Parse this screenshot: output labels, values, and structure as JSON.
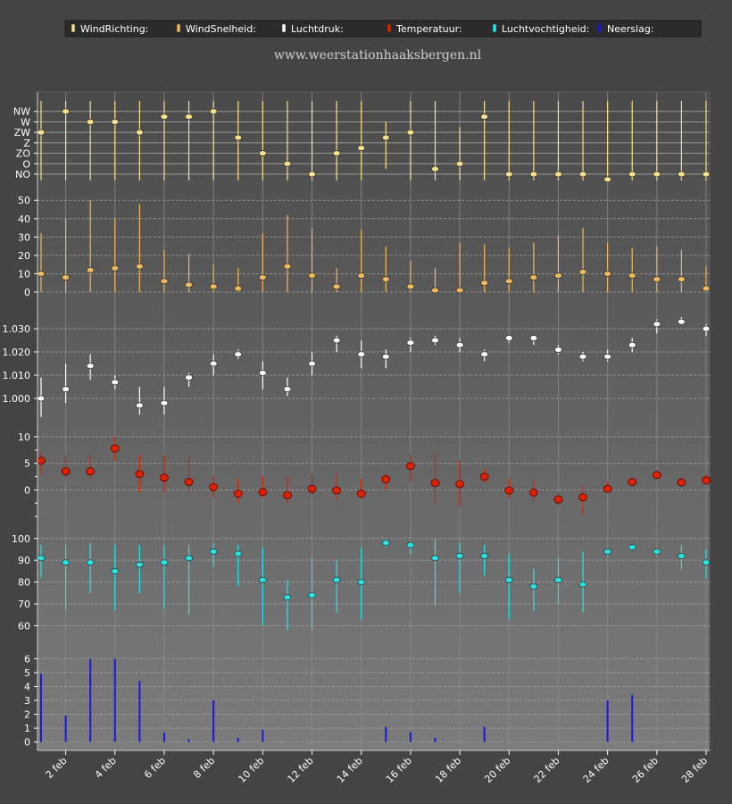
{
  "site": "www.weerstationhaaksbergen.nl",
  "legend": [
    {
      "label": "WindRichting:",
      "color": "#f7e08a"
    },
    {
      "label": "WindSnelheid:",
      "color": "#f0b95a"
    },
    {
      "label": "Luchtdruk:",
      "color": "#ffffff"
    },
    {
      "label": "Temperatuur:",
      "color": "#dd2200"
    },
    {
      "label": "Luchtvochtigheid:",
      "color": "#22e6e6"
    },
    {
      "label": "Neerslag:",
      "color": "#1a1ad8"
    }
  ],
  "chart_data": {
    "type": "scatter",
    "days": [
      1,
      2,
      3,
      4,
      5,
      6,
      7,
      8,
      9,
      10,
      11,
      12,
      13,
      14,
      15,
      16,
      17,
      18,
      19,
      20,
      21,
      22,
      23,
      24,
      25,
      26,
      27,
      28
    ],
    "x_tick_labels": [
      "2 feb",
      "4 feb",
      "6 feb",
      "8 feb",
      "10 feb",
      "12 feb",
      "14 feb",
      "16 feb",
      "18 feb",
      "20 feb",
      "22 feb",
      "24 feb",
      "26 feb",
      "28 feb"
    ],
    "x_tick_days": [
      2,
      4,
      6,
      8,
      10,
      12,
      14,
      16,
      18,
      20,
      22,
      24,
      26,
      28
    ],
    "panels": [
      {
        "name": "WindRichting",
        "type": "category",
        "color": "#f7e08a",
        "ticks": [
          "NW",
          "W",
          "ZW",
          "Z",
          "ZO",
          "O",
          "NO"
        ],
        "levels": [
          7,
          6,
          5,
          4,
          3,
          2,
          1
        ],
        "ylim": [
          0.4,
          8.6
        ],
        "values": [
          5,
          7,
          6,
          6,
          5,
          6.5,
          6.5,
          7,
          4.5,
          3,
          2,
          1,
          3,
          3.5,
          4.5,
          5,
          1.5,
          2,
          6.5,
          1,
          1,
          1,
          1,
          0.5,
          1,
          1,
          1,
          1
        ],
        "lows": [
          0.4,
          0.4,
          0.4,
          0.4,
          0.4,
          0.4,
          0.4,
          0.4,
          0.4,
          0.4,
          0.4,
          0.4,
          0.4,
          0.4,
          1.5,
          0.4,
          0.4,
          0.4,
          0.4,
          0.4,
          0.4,
          0.4,
          0.4,
          0.4,
          0.4,
          0.4,
          0.4,
          0.4
        ],
        "highs": [
          8,
          8,
          8,
          8,
          8,
          8,
          8,
          8,
          8,
          8,
          8,
          8,
          8,
          8,
          6,
          8,
          8,
          5.5,
          8,
          8,
          8,
          8,
          8,
          8,
          8,
          8,
          8,
          8
        ]
      },
      {
        "name": "WindSnelheid",
        "type": "linear",
        "color": "#f0b95a",
        "ticks": [
          0,
          10,
          20,
          30,
          40,
          50
        ],
        "ylim": [
          0,
          54
        ],
        "values": [
          10,
          8,
          12,
          13,
          14,
          6,
          4,
          3,
          2,
          8,
          14,
          9,
          3,
          9,
          7,
          3,
          1,
          1,
          5,
          6,
          8,
          9,
          11,
          10,
          9,
          7,
          7,
          2
        ],
        "lows": [
          0,
          0,
          0,
          0,
          0,
          0,
          0,
          0,
          0,
          0,
          0,
          0,
          0,
          0,
          0,
          0,
          0,
          0,
          0,
          0,
          0,
          0,
          0,
          0,
          0,
          0,
          0,
          0
        ],
        "highs": [
          32,
          40,
          50,
          40,
          48,
          23,
          21,
          15,
          13,
          32,
          42,
          35,
          13,
          34,
          25,
          17,
          13,
          27,
          26,
          24,
          27,
          31,
          35,
          27,
          24,
          25,
          23,
          14
        ]
      },
      {
        "name": "Luchtdruk",
        "type": "linear",
        "color": "#ffffff",
        "ticks": [
          1000,
          1010,
          1020,
          1030
        ],
        "tick_labels": [
          "1.000",
          "1.010",
          "1.020",
          "1.030"
        ],
        "ylim": [
          990,
          1035
        ],
        "values": [
          1000,
          1004,
          1014,
          1007,
          997,
          998,
          1009,
          1015,
          1019,
          1011,
          1004,
          1015,
          1025,
          1019,
          1018,
          1024,
          1025,
          1023,
          1019,
          1026,
          1026,
          1021,
          1018,
          1018,
          1023,
          1032,
          1033,
          1030
        ],
        "lows": [
          992,
          998,
          1008,
          1004,
          993,
          993,
          1005,
          1010,
          1017,
          1004,
          1001,
          1010,
          1020,
          1013,
          1013,
          1020,
          1023,
          1020,
          1016,
          1024,
          1023,
          1019,
          1016,
          1016,
          1020,
          1028,
          1032,
          1027
        ],
        "highs": [
          1009,
          1015,
          1019,
          1010,
          1005,
          1005,
          1011,
          1019,
          1021,
          1016,
          1009,
          1020,
          1027,
          1025,
          1021,
          1026,
          1027,
          1026,
          1021,
          1027,
          1027,
          1023,
          1020,
          1021,
          1026,
          1034,
          1035,
          1032
        ]
      },
      {
        "name": "Temperatuur",
        "type": "linear",
        "color": "#dd2200",
        "ticks": [
          0,
          5,
          10
        ],
        "minor_ticks": [
          -5,
          -2.5,
          2.5,
          7.5
        ],
        "ylim": [
          -7,
          11.5
        ],
        "values": [
          5.5,
          3.5,
          3.5,
          7.8,
          3,
          2.3,
          1.5,
          0.5,
          -0.7,
          -0.4,
          -1,
          0.2,
          -0.1,
          -0.7,
          2,
          4.5,
          1.3,
          1.1,
          2.5,
          -0.1,
          -0.5,
          -1.8,
          -1.4,
          0.2,
          1.5,
          2.8,
          1.4,
          1.8
        ],
        "lows": [
          3,
          2,
          2,
          5.5,
          -0.5,
          -0.5,
          -0.5,
          -1.5,
          -2.5,
          -1.5,
          -2.5,
          -1,
          -2,
          -1.7,
          0,
          1.5,
          -2.5,
          -3,
          1.3,
          -1.5,
          -2,
          -3,
          -4.5,
          -0.5,
          1.3,
          2,
          0.7,
          1
        ],
        "highs": [
          7,
          6.5,
          6.5,
          10,
          6.5,
          6.5,
          6.5,
          2.5,
          2,
          2.5,
          2.5,
          3,
          3,
          2,
          3,
          6.5,
          7,
          5.5,
          4,
          2,
          1.8,
          -0.5,
          0.5,
          1.5,
          2,
          3.7,
          2.5,
          3
        ]
      },
      {
        "name": "Luchtvochtigheid",
        "type": "linear",
        "color": "#22e6e6",
        "ticks": [
          60,
          70,
          80,
          90,
          100
        ],
        "ylim": [
          52,
          104
        ],
        "values": [
          91,
          89,
          89,
          85,
          88,
          89,
          91,
          94,
          93,
          81,
          73,
          74,
          81,
          80,
          98,
          97,
          91,
          92,
          92,
          81,
          78,
          81,
          79,
          94,
          96,
          94,
          92,
          89
        ],
        "lows": [
          82,
          67,
          75,
          67,
          75,
          68,
          65,
          87,
          78,
          60,
          58,
          58,
          66,
          63,
          96,
          93,
          69,
          75,
          83,
          63,
          67,
          70,
          66,
          92,
          95,
          92,
          86,
          82
        ],
        "highs": [
          97,
          97,
          98,
          97,
          97,
          97,
          97,
          98,
          97,
          96,
          81,
          91,
          90,
          96,
          100,
          98,
          100,
          98,
          97,
          93,
          86,
          91,
          94,
          95,
          97,
          95,
          97,
          95
        ]
      },
      {
        "name": "Neerslag",
        "type": "bar",
        "color": "#1a1ad8",
        "ticks": [
          0,
          1,
          2,
          3,
          4,
          5,
          6
        ],
        "ylim": [
          -0.6,
          6.6
        ],
        "values": [
          4.9,
          1.9,
          6.0,
          6.0,
          4.4,
          0.7,
          0.2,
          3.0,
          0.3,
          0.9,
          0,
          0,
          0,
          0,
          1.1,
          0.7,
          0.3,
          0,
          1.1,
          0,
          0,
          0,
          0,
          3.0,
          3.4,
          0,
          0,
          0
        ]
      }
    ]
  }
}
